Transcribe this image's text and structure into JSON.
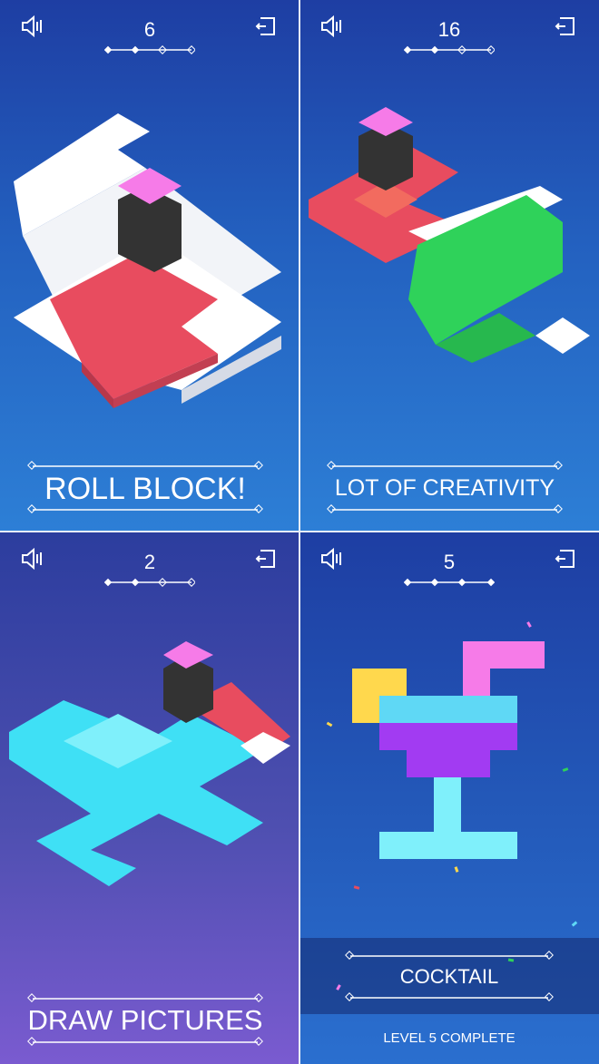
{
  "panels": [
    {
      "id": "p1",
      "level": "6",
      "caption": "ROLL BLOCK!",
      "progress": {
        "steps": 4,
        "current": 2
      }
    },
    {
      "id": "p2",
      "level": "16",
      "caption": "LOT OF CREATIVITY",
      "progress": {
        "steps": 4,
        "current": 2
      }
    },
    {
      "id": "p3",
      "level": "2",
      "caption": "DRAW PICTURES",
      "progress": {
        "steps": 4,
        "current": 2
      }
    },
    {
      "id": "p4",
      "level": "5",
      "caption": "COCKTAIL",
      "subcaption": "LEVEL 5 COMPLETE",
      "progress": {
        "steps": 4,
        "current": 4
      }
    }
  ],
  "icons": {
    "sound": "sound-icon",
    "back": "back-icon"
  },
  "colors": {
    "red": "#e84c5f",
    "white": "#ffffff",
    "green": "#2fd25a",
    "cyan": "#3fe0f5",
    "pink": "#f67be8",
    "purple": "#a23bf2",
    "yellow": "#ffd84d"
  }
}
